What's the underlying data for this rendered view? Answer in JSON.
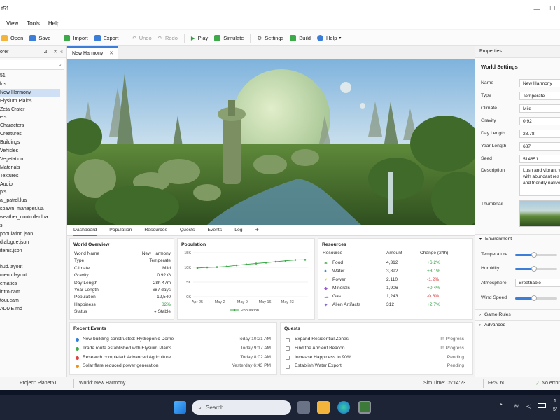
{
  "window": {
    "title": "t51",
    "minimize_glyph": "—",
    "maximize_glyph": "☐"
  },
  "menu": [
    "View",
    "Tools",
    "Help"
  ],
  "toolbar": {
    "open": "Open",
    "save": "Save",
    "import": "Import",
    "export": "Export",
    "undo": "Undo",
    "redo": "Redo",
    "play": "Play",
    "simulate": "Simulate",
    "settings": "Settings",
    "build": "Build",
    "help": "Help"
  },
  "explorer": {
    "title": "orer",
    "items": [
      "51",
      "lds",
      "New Harmony",
      "Elysium Plains",
      "Zeta Crater",
      "ets",
      "Characters",
      "Creatures",
      "Buildings",
      "Vehicles",
      "Vegetation",
      "Materials",
      "Textures",
      "Audio",
      "pts",
      "ai_patrol.lua",
      "spawn_manager.lua",
      "weather_controller.lua",
      "s",
      "population.json",
      "dialogue.json",
      "items.json",
      "",
      "hud.layout",
      "menu.layout",
      "ematics",
      "intro.cam",
      "tour.cam",
      "ADME.md"
    ]
  },
  "document": {
    "tab": "New Harmony",
    "close_glyph": "✕"
  },
  "bottom_tabs": [
    "Dashboard",
    "Population",
    "Resources",
    "Quests",
    "Events",
    "Log",
    "+"
  ],
  "overview": {
    "title": "World Overview",
    "rows": [
      {
        "k": "World Name",
        "v": "New Harmony"
      },
      {
        "k": "Type",
        "v": "Temperate"
      },
      {
        "k": "Climate",
        "v": "Mild"
      },
      {
        "k": "Gravity",
        "v": "0.92 G"
      },
      {
        "k": "Day Length",
        "v": "28h 47m"
      },
      {
        "k": "Year Length",
        "v": "687 days"
      },
      {
        "k": "Population",
        "v": "12,540"
      },
      {
        "k": "Happiness",
        "v": "82%"
      },
      {
        "k": "Status",
        "v": "Stable"
      }
    ]
  },
  "population_chart": {
    "title": "Population",
    "legend": "Population",
    "color": "#3daa4a",
    "y_ticks": [
      "15K",
      "10K",
      "5K",
      "0K"
    ],
    "x_ticks": [
      "Apr 25",
      "May 2",
      "May 9",
      "May 16",
      "May 23"
    ]
  },
  "chart_data": {
    "type": "line",
    "title": "Population",
    "x": [
      "Apr 25",
      "Apr 28",
      "May 1",
      "May 4",
      "May 7",
      "May 10",
      "May 13",
      "May 16",
      "May 19",
      "May 22",
      "May 25",
      "May 28"
    ],
    "series": [
      {
        "name": "Population",
        "values": [
          9800,
          10000,
          10100,
          10300,
          10700,
          11000,
          11300,
          11600,
          11900,
          12200,
          12500,
          12540
        ]
      }
    ],
    "ylim": [
      0,
      15000
    ],
    "y_ticks": [
      "15K",
      "10K",
      "5K",
      "0K"
    ],
    "x_ticks": [
      "Apr 25",
      "May 2",
      "May 9",
      "May 16",
      "May 23"
    ],
    "grid": true,
    "legend": "bottom"
  },
  "resources": {
    "title": "Resources",
    "headers": [
      "Resource",
      "Amount",
      "Change (24h)"
    ],
    "rows": [
      {
        "name": "Food",
        "amount": "4,312",
        "change": "+6.2%",
        "icon": "leaf-icon",
        "color": "#4caf50",
        "positive": true
      },
      {
        "name": "Water",
        "amount": "3,892",
        "change": "+3.1%",
        "icon": "water-drop-icon",
        "color": "#2f8fe0",
        "positive": true
      },
      {
        "name": "Power",
        "amount": "2,110",
        "change": "-1.2%",
        "icon": "lightning-icon",
        "color": "#f0b400",
        "positive": false
      },
      {
        "name": "Minerals",
        "amount": "1,906",
        "change": "+0.4%",
        "icon": "gem-icon",
        "color": "#9c5bd0",
        "positive": true
      },
      {
        "name": "Gas",
        "amount": "1,243",
        "change": "-0.8%",
        "icon": "cloud-icon",
        "color": "#9aa3ad",
        "positive": false
      },
      {
        "name": "Alien Artifacts",
        "amount": "312",
        "change": "+2.7%",
        "icon": "artifact-icon",
        "color": "#8a63c8",
        "positive": true
      }
    ]
  },
  "events": {
    "title": "Recent Events",
    "rows": [
      {
        "text": "New building constructed: Hydroponic Dome",
        "time": "Today 10:21 AM",
        "color": "#2f7fe0"
      },
      {
        "text": "Trade route established with Elysium Plains",
        "time": "Today 9:17 AM",
        "color": "#3daa4a"
      },
      {
        "text": "Research completed: Advanced Agriculture",
        "time": "Today 8:02 AM",
        "color": "#e04040"
      },
      {
        "text": "Solar flare reduced power generation",
        "time": "Yesterday 6:43 PM",
        "color": "#f09020"
      }
    ]
  },
  "quests": {
    "title": "Quests",
    "rows": [
      {
        "text": "Expand Residential Zones",
        "status": "In Progress"
      },
      {
        "text": "Find the Ancient Beacon",
        "status": "In Progress"
      },
      {
        "text": "Increase Happiness to 90%",
        "status": "Pending"
      },
      {
        "text": "Establish Water Export",
        "status": "Pending"
      }
    ]
  },
  "properties": {
    "panel_title": "Properties",
    "section": "World Settings",
    "fields": [
      {
        "label": "Name",
        "value": "New Harmony"
      },
      {
        "label": "Type",
        "value": "Temperate"
      },
      {
        "label": "Climate",
        "value": "Mild"
      },
      {
        "label": "Gravity",
        "value": "0.92"
      },
      {
        "label": "Day Length",
        "value": "28.78"
      },
      {
        "label": "Year Length",
        "value": "687"
      },
      {
        "label": "Seed",
        "value": "514851"
      }
    ],
    "description_label": "Description",
    "description": "Lush and vibrant w with abundant res and friendly native",
    "thumbnail_label": "Thumbnail",
    "environment": {
      "title": "Environment",
      "temperature_label": "Temperature",
      "temperature": 0.45,
      "humidity_label": "Humidity",
      "humidity": 0.45,
      "atmosphere_label": "Atmosphere",
      "atmosphere": "Breathable",
      "wind_label": "Wind Speed",
      "wind": 0.45
    },
    "game_rules": "Game Rules",
    "advanced": "Advanced"
  },
  "status": {
    "project": "Project: Planet51",
    "world": "World: New Harmony",
    "sim_time": "Sim Time: 05:14:23",
    "fps": "FPS: 60",
    "errors": "No error"
  },
  "taskbar": {
    "search": "Search",
    "clock_time": "1",
    "clock_date": "5/"
  }
}
